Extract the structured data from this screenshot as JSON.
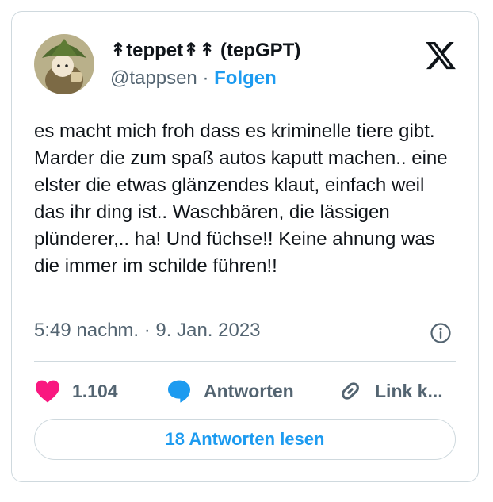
{
  "user": {
    "display_name": "↟teppet↟↟ (tepGPT)",
    "handle": "@tappsen",
    "separator": "·",
    "follow_label": "Folgen"
  },
  "tweet": {
    "text": "es macht mich froh dass es kriminelle tiere gibt. Marder die zum spaß autos kaputt machen.. eine elster die etwas glänzendes klaut, einfach weil das ihr ding ist.. Waschbären, die lässigen plünderer,.. ha! Und füchse!! Keine ahnung was die immer im schilde führen!!",
    "timestamp": "5:49 nachm. · 9. Jan. 2023"
  },
  "actions": {
    "like_count": "1.104",
    "reply_label": "Antworten",
    "copy_link_label": "Link k...",
    "read_replies_label": "18 Antworten lesen"
  },
  "icons": {
    "brand": "x-logo-icon",
    "info": "info-icon",
    "like": "heart-icon",
    "reply": "speech-bubble-icon",
    "copy": "link-icon"
  },
  "colors": {
    "accent": "#1d9bf0",
    "heart": "#f91880",
    "text": "#0f1419",
    "muted": "#536471",
    "border": "#cfd9de"
  }
}
